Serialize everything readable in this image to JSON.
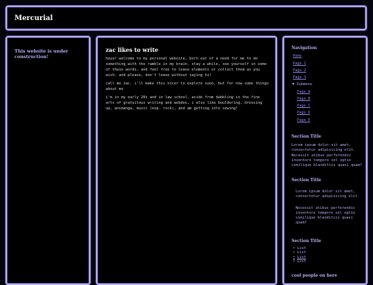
{
  "header": {
    "site_title": "Mercurial"
  },
  "left": {
    "note": "This website is under construction!"
  },
  "main": {
    "title": "zac likes to write",
    "paragraphs": [
      "heya! welcome to my personal website, born out of a need for me to do something with the ramble in my brain. stay a while, see yourself in some of these words, and feel free to leave elements or collect them as you wish. and please, don't leave without saying hi!",
      "call me zac. i'll make this nicer to explore soon, but for now some things about me",
      "i'm in my early 20s and in law school. aside from dabbling in the fine arts of gratuitous writing and webdev, i also like bouldering, dressing up, animanga, music (esp. rock), and am getting into sewing!"
    ]
  },
  "right": {
    "nav_title": "Navigation",
    "nav_items": [
      "Home",
      "Page 1",
      "Page 2",
      "Page 3"
    ],
    "submenu_label": "▼ Submenu",
    "submenu_items": [
      "Page A",
      "Page B",
      "Page C",
      "Page D",
      "Page E"
    ],
    "section1": {
      "title": "Section Title",
      "p1": "Lorem ipsum dolor sit amet, consectetur adipisicing elit.",
      "p2": "Necessit atibus perferendis inventore tempore vel optio similique blanditiis quasi quam?"
    },
    "section2": {
      "title": "Section Title",
      "p1": "Lorem ipsum dolor sit amet, consectetur adipisicing elit.",
      "p2": "Necessit atibus perferendis inventore tempore vel optio similique blanditiis quasi quam?"
    },
    "section3": {
      "title": "Section Title",
      "list": [
        "List",
        "List",
        "List",
        "List"
      ]
    },
    "cool_people_title": "cool people on here"
  }
}
